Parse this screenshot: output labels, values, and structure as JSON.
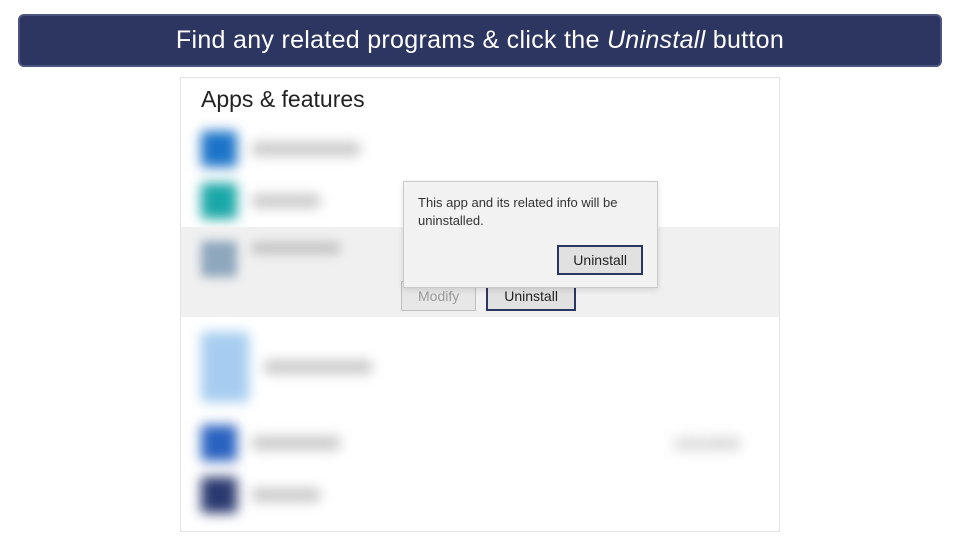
{
  "banner": {
    "prefix": "Find any related programs & click the ",
    "italic": "Uninstall",
    "suffix": " button"
  },
  "page": {
    "title": "Apps & features"
  },
  "popup": {
    "message": "This app and its related info will be uninstalled.",
    "confirm": "Uninstall"
  },
  "buttons": {
    "modify": "Modify",
    "uninstall": "Uninstall"
  },
  "dates": {
    "row6": "12/21/2023"
  }
}
